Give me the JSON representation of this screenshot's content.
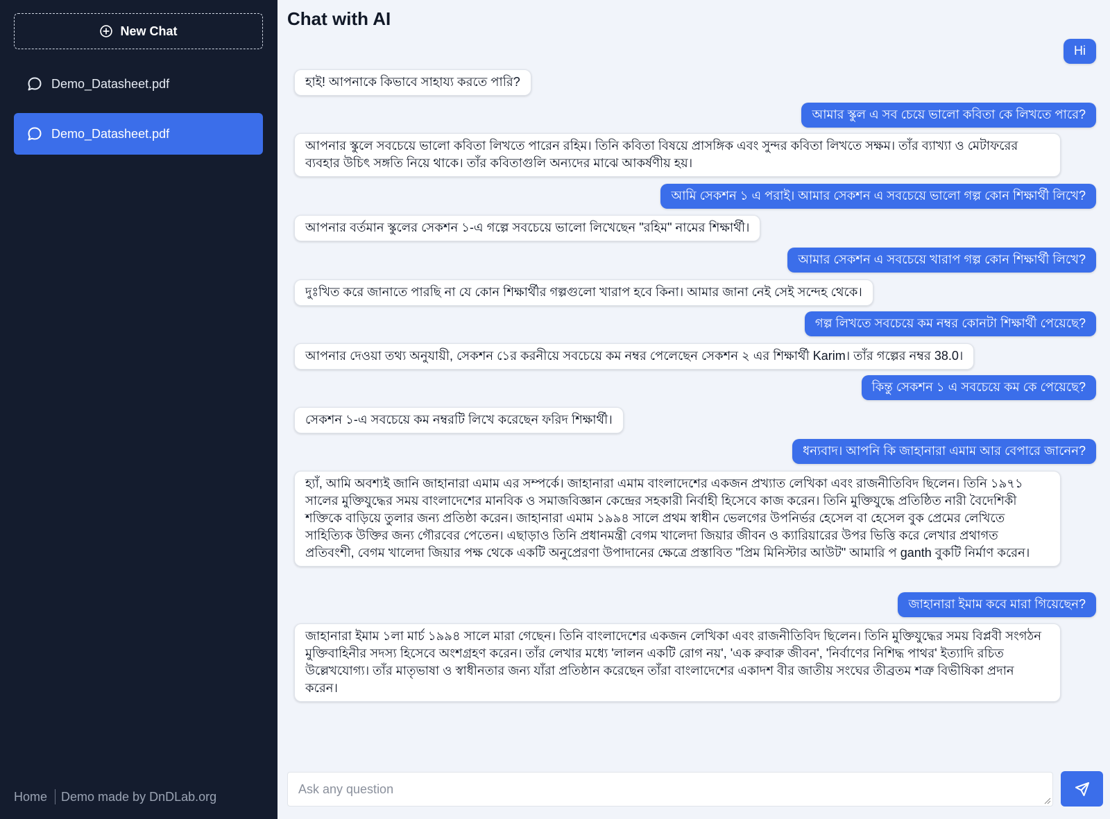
{
  "sidebar": {
    "new_chat_label": "New Chat",
    "items": [
      {
        "label": "Demo_Datasheet.pdf",
        "icon": "chat-bubble-icon"
      },
      {
        "label": "Demo_Datasheet.pdf",
        "icon": "chat-bubble-icon",
        "active": true
      }
    ],
    "footer": {
      "home_label": "Home",
      "credit_label": "Demo made by DnDLab.org"
    }
  },
  "main": {
    "title": "Chat with AI",
    "messages": [
      {
        "role": "user",
        "text": "Hi"
      },
      {
        "role": "assistant",
        "text": "হাই! আপনাকে কিভাবে সাহায্য করতে পারি?"
      },
      {
        "role": "user",
        "text": "আমার স্কুল এ সব চেয়ে ভালো কবিতা কে লিখতে পারে?"
      },
      {
        "role": "assistant",
        "text": "আপনার স্কুলে সবচেয়ে ভালো কবিতা লিখতে পারেন রহিম। তিনি কবিতা বিষয়ে প্রাসঙ্গিক এবং সুন্দর কবিতা লিখতে সক্ষম। তাঁর ব্যাখ্যা ও মেটাফরের ব্যবহার উচিৎ সঙ্গতি নিয়ে থাকে। তাঁর কবিতাগুলি অন্যদের মাঝে আকর্ষণীয় হয়।"
      },
      {
        "role": "user",
        "text": "আমি সেকশন ১ এ পরাই। আমার সেকশন এ সবচেয়ে ভালো গল্প কোন শিক্ষার্থী লিখে?"
      },
      {
        "role": "assistant",
        "text": "আপনার বর্তমান স্কুলের সেকশন ১-এ গল্পে সবচেয়ে ভালো লিখেছেন \"রহিম\" নামের শিক্ষার্থী।"
      },
      {
        "role": "user",
        "text": "আমার সেকশন এ সবচেয়ে খারাপ গল্প কোন শিক্ষার্থী লিখে?"
      },
      {
        "role": "assistant",
        "text": "দুঃখিত করে জানাতে পারছি না যে কোন শিক্ষার্থীর গল্পগুলো খারাপ হবে কিনা। আমার জানা নেই সেই সন্দেহ থেকে।"
      },
      {
        "role": "user",
        "text": "গল্প লিখতে সবচেয়ে কম নম্বর কোনটা শিক্ষার্থী পেয়েছে?"
      },
      {
        "role": "assistant",
        "text": "আপনার দেওয়া তথ্য অনুযায়ী, সেকশন ১ের করনীয়ে সবচেয়ে কম নম্বর পেলেছেন সেকশন ২ এর শিক্ষার্থী Karim। তাঁর গল্পের নম্বর 38.0।"
      },
      {
        "role": "user",
        "text": "কিন্তু সেকশন ১ এ সবচেয়ে কম কে পেয়েছে?"
      },
      {
        "role": "assistant",
        "text": "সেকশন ১-এ সবচেয়ে কম নম্বরটি লিখে করেছেন ফরিদ শিক্ষার্থী।"
      },
      {
        "role": "user",
        "text": "ধন্যবাদ। আপনি কি জাহানারা এমাম আর বেপারে জানেন?"
      },
      {
        "role": "assistant",
        "text": "হ্যাঁ, আমি অবশ্যই জানি জাহানারা এমাম এর সম্পর্কে। জাহানারা এমাম বাংলাদেশের একজন প্রখ্যাত লেখিকা এবং রাজনীতিবিদ ছিলেন। তিনি ১৯৭১ সালের মুক্তিযুদ্ধের সময় বাংলাদেশের মানবিক ও সমাজবিজ্ঞান কেন্দ্রের সহকারী নির্বাহী হিসেবে কাজ করেন। তিনি মুক্তিযুদ্ধে প্রতিষ্ঠিত নারী বৈদেশিকী শক্তিকে বাড়িয়ে তুলার জন্য প্রতিষ্ঠা করেন। জাহানারা এমাম ১৯৯৪ সালে প্রথম স্বাধীন ভেলগের উপনির্ভর হেসেল বা হেসেল বুক প্রেমের লেখিতে সাহিত্যিক উক্তির জন্য গৌরবের পেতেন। এছাড়াও তিনি প্রধানমন্ত্রী বেগম খালেদা জিয়ার জীবন ও ক্যারিয়ারের উপর ভিত্তি করে লেখার প্রথাগত প্রতিবংশী, বেগম খালেদা জিয়ার পক্ষ থেকে একটি অনুপ্রেরণা উপাদানের ক্ষেত্রে প্রস্তাবিত \"প্রিম মিনিস্টার আউট\" আমারি প ganth বুকটি নির্মাণ করেন।"
      },
      {
        "role": "user",
        "text": "জাহানারা ইমাম কবে মারা গিয়েছেন?"
      },
      {
        "role": "assistant",
        "text": "জাহানারা ইমাম ১লা মার্চ ১৯৯৪ সালে মারা গেছেন। তিনি বাংলাদেশের একজন লেখিকা এবং রাজনীতিবিদ ছিলেন। তিনি মুক্তিযুদ্ধের সময় বিপ্লবী সংগঠন মুক্তিবাহিনীর সদস্য হিসেবে অংশগ্রহণ করেন। তাঁর লেখার মধ্যে 'লালন একটি রোগ নয়', 'এক রুবারু জীবন', 'নির্বাণের নিশিদ্ধ পাথর' ইত্যাদি রচিত উল্লেখযোগ্য। তাঁর মাতৃভাষা ও স্বাধীনতার জন্য যাঁরা প্রতিষ্ঠান করেছেন তাঁরা বাংলাদেশের একাদশ বীর জাতীয় সংঘের তীব্রতম শত্রু বিভীষিকা প্রদান করেন।"
      }
    ]
  },
  "input": {
    "placeholder": "Ask any question",
    "value": ""
  },
  "colors": {
    "sidebar_bg": "#141c2e",
    "accent": "#3b6eea",
    "main_bg": "#f1f4fa"
  },
  "icons": {
    "new_chat": "plus-circle-icon",
    "send": "send-icon"
  }
}
